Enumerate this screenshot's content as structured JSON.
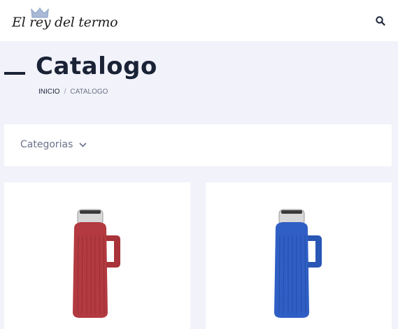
{
  "header": {
    "logo_text": "El rey del termo",
    "search_icon": "search-icon"
  },
  "hero": {
    "title": "Catalogo",
    "breadcrumb": {
      "home": "INICIO",
      "separator": "/",
      "current": "CATALOGO"
    }
  },
  "filter": {
    "label": "Categorias",
    "icon": "chevron-down-icon"
  },
  "products": [
    {
      "color_name": "red",
      "color": "#b23a40"
    },
    {
      "color_name": "blue",
      "color": "#2f5fc4"
    }
  ],
  "colors": {
    "background": "#f1f2fa",
    "header_bg": "#ffffff",
    "title": "#1a2236",
    "muted": "#6b7189"
  }
}
